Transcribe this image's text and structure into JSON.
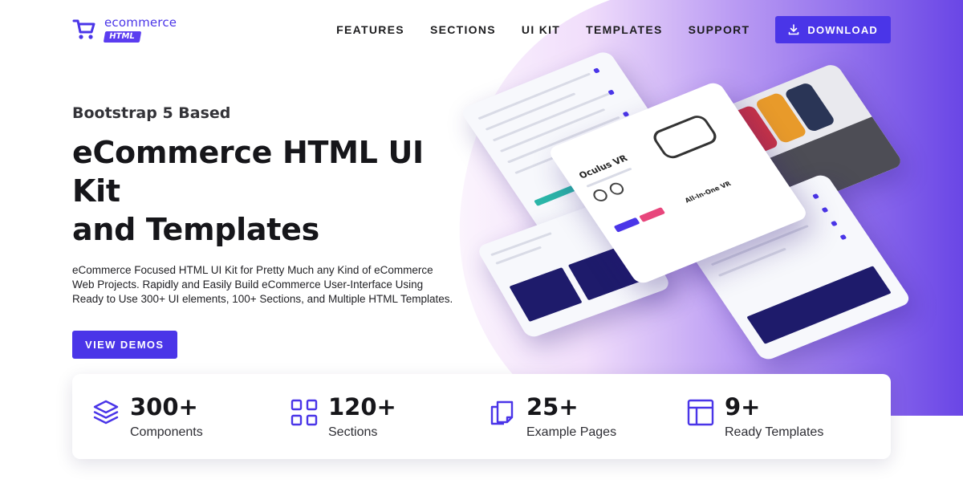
{
  "colors": {
    "accent": "#4a35e8",
    "accent_light": "#a98cf0",
    "navy": "#1e1b6b"
  },
  "logo": {
    "word": "ecommerce",
    "tag": "HTML",
    "icon": "cart-icon"
  },
  "nav": {
    "items": [
      "FEATURES",
      "SECTIONS",
      "UI KIT",
      "TEMPLATES",
      "SUPPORT"
    ],
    "download_label": "DOWNLOAD",
    "download_icon": "download-icon"
  },
  "hero": {
    "eyebrow": "Bootstrap 5 Based",
    "headline_line1": "eCommerce HTML UI Kit",
    "headline_line2": "and Templates",
    "description": "eCommerce Focused HTML UI Kit for Pretty Much any Kind of eCommerce Web Projects. Rapidly and Easily Build eCommerce User-Interface Using Ready to Use 300+ UI elements, 100+ Sections, and Multiple HTML Templates.",
    "cta_label": "VIEW DEMOS"
  },
  "mockups": {
    "product_title": "Oculus VR",
    "hero_caption": "All-In-One VR"
  },
  "stats": [
    {
      "value": "300+",
      "label": "Components",
      "icon": "layers-icon"
    },
    {
      "value": "120+",
      "label": "Sections",
      "icon": "grid-icon"
    },
    {
      "value": "25+",
      "label": "Example Pages",
      "icon": "pages-icon"
    },
    {
      "value": "9+",
      "label": "Ready Templates",
      "icon": "template-icon"
    }
  ]
}
